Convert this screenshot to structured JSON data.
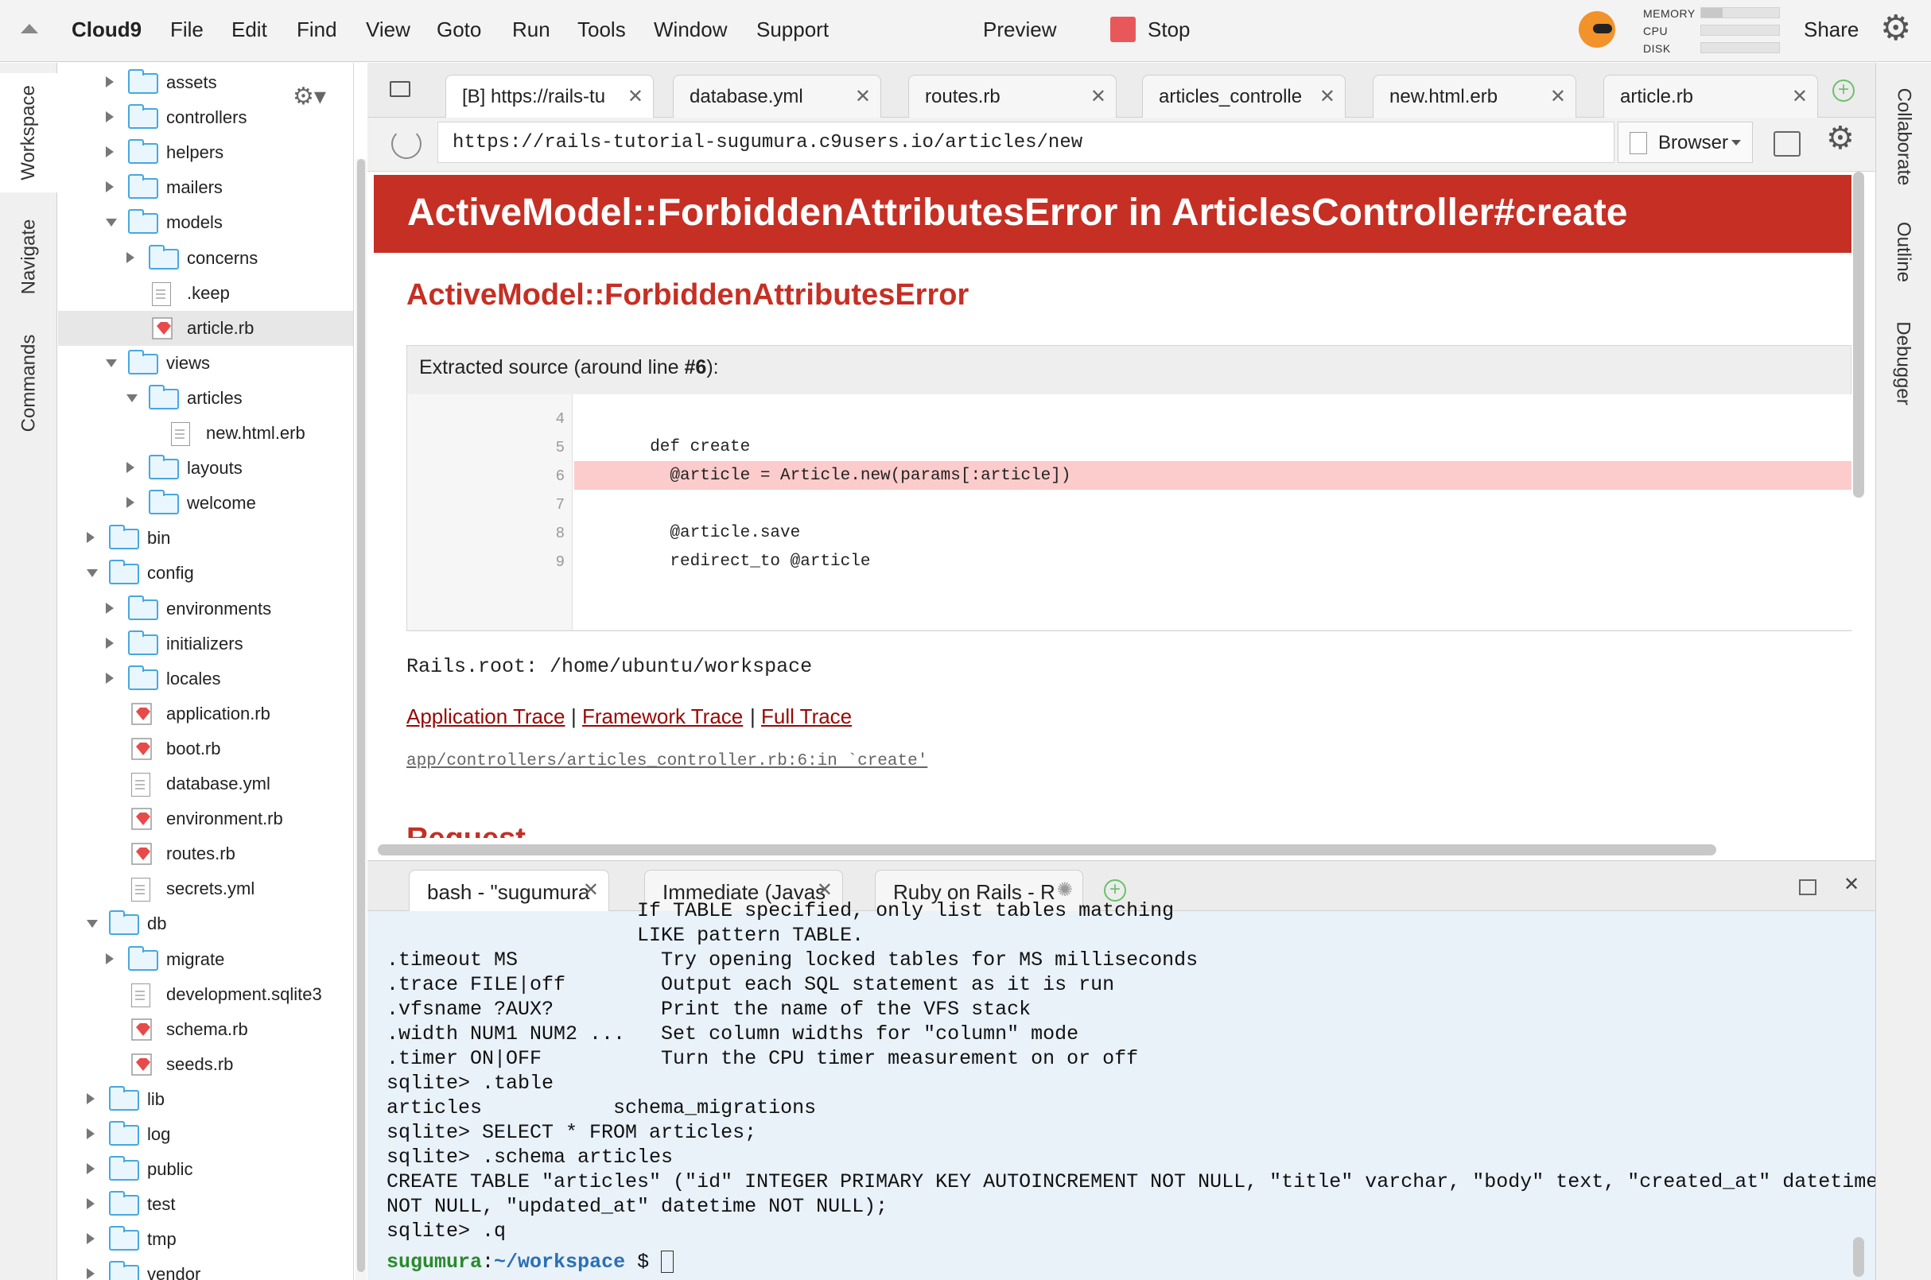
{
  "menubar": {
    "app": "Cloud9",
    "items": [
      "File",
      "Edit",
      "Find",
      "View",
      "Goto",
      "Run",
      "Tools",
      "Window",
      "Support"
    ],
    "preview": "Preview",
    "stop": "Stop",
    "share": "Share",
    "meters": {
      "memory_label": "MEMORY",
      "cpu_label": "CPU",
      "disk_label": "DISK",
      "memory": 0.28,
      "cpu": 0.0,
      "disk": 0.0
    }
  },
  "left_panel_tabs": [
    "Workspace",
    "Navigate",
    "Commands"
  ],
  "right_panel_tabs": [
    "Collaborate",
    "Outline",
    "Debugger"
  ],
  "tree": [
    {
      "name": "assets",
      "kind": "folder",
      "depth": 2,
      "state": "closed"
    },
    {
      "name": "controllers",
      "kind": "folder",
      "depth": 2,
      "state": "closed"
    },
    {
      "name": "helpers",
      "kind": "folder",
      "depth": 2,
      "state": "closed"
    },
    {
      "name": "mailers",
      "kind": "folder",
      "depth": 2,
      "state": "closed"
    },
    {
      "name": "models",
      "kind": "folder",
      "depth": 2,
      "state": "open"
    },
    {
      "name": "concerns",
      "kind": "folder",
      "depth": 3,
      "state": "closed"
    },
    {
      "name": ".keep",
      "kind": "file",
      "depth": 3
    },
    {
      "name": "article.rb",
      "kind": "ruby",
      "depth": 3,
      "selected": true
    },
    {
      "name": "views",
      "kind": "folder",
      "depth": 2,
      "state": "open"
    },
    {
      "name": "articles",
      "kind": "folder",
      "depth": 3,
      "state": "open"
    },
    {
      "name": "new.html.erb",
      "kind": "file",
      "depth": 4
    },
    {
      "name": "layouts",
      "kind": "folder",
      "depth": 3,
      "state": "closed"
    },
    {
      "name": "welcome",
      "kind": "folder",
      "depth": 3,
      "state": "closed"
    },
    {
      "name": "bin",
      "kind": "folder",
      "depth": 1,
      "state": "closed"
    },
    {
      "name": "config",
      "kind": "folder",
      "depth": 1,
      "state": "open"
    },
    {
      "name": "environments",
      "kind": "folder",
      "depth": 2,
      "state": "closed"
    },
    {
      "name": "initializers",
      "kind": "folder",
      "depth": 2,
      "state": "closed"
    },
    {
      "name": "locales",
      "kind": "folder",
      "depth": 2,
      "state": "closed"
    },
    {
      "name": "application.rb",
      "kind": "ruby",
      "depth": 2
    },
    {
      "name": "boot.rb",
      "kind": "ruby",
      "depth": 2
    },
    {
      "name": "database.yml",
      "kind": "file",
      "depth": 2
    },
    {
      "name": "environment.rb",
      "kind": "ruby",
      "depth": 2
    },
    {
      "name": "routes.rb",
      "kind": "ruby",
      "depth": 2
    },
    {
      "name": "secrets.yml",
      "kind": "file",
      "depth": 2
    },
    {
      "name": "db",
      "kind": "folder",
      "depth": 1,
      "state": "open"
    },
    {
      "name": "migrate",
      "kind": "folder",
      "depth": 2,
      "state": "closed"
    },
    {
      "name": "development.sqlite3",
      "kind": "file",
      "depth": 2
    },
    {
      "name": "schema.rb",
      "kind": "ruby",
      "depth": 2
    },
    {
      "name": "seeds.rb",
      "kind": "ruby",
      "depth": 2
    },
    {
      "name": "lib",
      "kind": "folder",
      "depth": 1,
      "state": "closed"
    },
    {
      "name": "log",
      "kind": "folder",
      "depth": 1,
      "state": "closed"
    },
    {
      "name": "public",
      "kind": "folder",
      "depth": 1,
      "state": "closed"
    },
    {
      "name": "test",
      "kind": "folder",
      "depth": 1,
      "state": "closed"
    },
    {
      "name": "tmp",
      "kind": "folder",
      "depth": 1,
      "state": "closed"
    },
    {
      "name": "vendor",
      "kind": "folder",
      "depth": 1,
      "state": "closed"
    }
  ],
  "editor_tabs": [
    {
      "label": "[B] https://rails-tu",
      "active": true
    },
    {
      "label": "database.yml"
    },
    {
      "label": "routes.rb"
    },
    {
      "label": "articles_controlle"
    },
    {
      "label": "new.html.erb"
    },
    {
      "label": "article.rb"
    }
  ],
  "browser": {
    "url": "https://rails-tutorial-sugumura.c9users.io/articles/new",
    "mode": "Browser"
  },
  "error_page": {
    "header": "ActiveModel::ForbiddenAttributesError in ArticlesController#create",
    "title": "ActiveModel::ForbiddenAttributesError",
    "extracted_prefix": "Extracted source (around line ",
    "extracted_line": "#6",
    "extracted_suffix": "):",
    "source": [
      {
        "n": "4",
        "code": ""
      },
      {
        "n": "5",
        "code": "  def create"
      },
      {
        "n": "6",
        "code": "    @article = Article.new(params[:article])",
        "highlight": true
      },
      {
        "n": "7",
        "code": ""
      },
      {
        "n": "8",
        "code": "    @article.save"
      },
      {
        "n": "9",
        "code": "    redirect_to @article"
      }
    ],
    "rails_root": "Rails.root: /home/ubuntu/workspace",
    "trace_links": [
      "Application Trace",
      "Framework Trace",
      "Full Trace"
    ],
    "trace_sep": "|",
    "trace_line": "app/controllers/articles_controller.rb:6:in `create'",
    "next_section": "Request"
  },
  "terminal_tabs": [
    {
      "label": "bash - \"sugumura",
      "active": true
    },
    {
      "label": "Immediate (Javas"
    },
    {
      "label": "Ruby on Rails - R"
    }
  ],
  "terminal": {
    "lines": [
      "                     If TABLE specified, only list tables matching",
      "                     LIKE pattern TABLE.",
      ".timeout MS            Try opening locked tables for MS milliseconds",
      ".trace FILE|off        Output each SQL statement as it is run",
      ".vfsname ?AUX?         Print the name of the VFS stack",
      ".width NUM1 NUM2 ...   Set column widths for \"column\" mode",
      ".timer ON|OFF          Turn the CPU timer measurement on or off",
      "sqlite> .table",
      "articles           schema_migrations",
      "sqlite> SELECT * FROM articles;",
      "sqlite> .schema articles",
      "CREATE TABLE \"articles\" (\"id\" INTEGER PRIMARY KEY AUTOINCREMENT NOT NULL, \"title\" varchar, \"body\" text, \"created_at\" datetime",
      "NOT NULL, \"updated_at\" datetime NOT NULL);",
      "sqlite> .q"
    ],
    "prompt_user": "sugumura",
    "prompt_sep": ":",
    "prompt_path": "~/workspace",
    "prompt_end": " $ "
  },
  "colors": {
    "error_red": "#c52f24",
    "link_red": "#980905",
    "highlight": "#fccbcb",
    "stop": "#e8585b"
  }
}
